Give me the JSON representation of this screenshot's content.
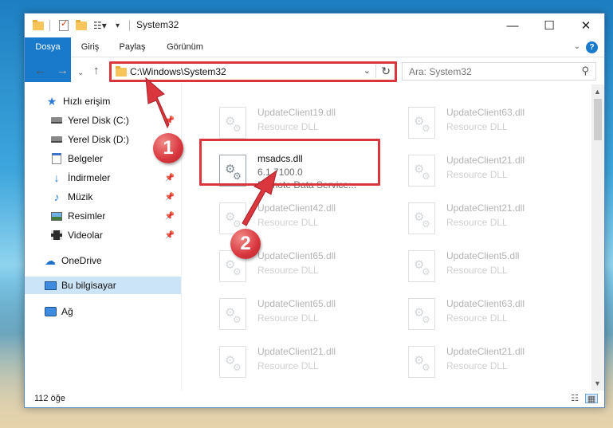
{
  "window": {
    "title": "System32",
    "minimize_glyph": "—",
    "maximize_glyph": "☐",
    "close_glyph": "✕"
  },
  "ribbon": {
    "tabs": [
      "Dosya",
      "Giriş",
      "Paylaş",
      "Görünüm"
    ],
    "help_glyph": "?"
  },
  "nav": {
    "address_path": "C:\\Windows\\System32",
    "search_placeholder": "Ara: System32"
  },
  "sidebar": {
    "items": [
      {
        "label": "Hızlı erişim",
        "icon": "star-icon"
      },
      {
        "label": "Yerel Disk (C:)",
        "icon": "disk-icon",
        "pinned": true
      },
      {
        "label": "Yerel Disk (D:)",
        "icon": "disk-icon",
        "pinned": true
      },
      {
        "label": "Belgeler",
        "icon": "documents-icon",
        "pinned": true
      },
      {
        "label": "İndirmeler",
        "icon": "download-icon",
        "pinned": true
      },
      {
        "label": "Müzik",
        "icon": "music-icon",
        "pinned": true
      },
      {
        "label": "Resimler",
        "icon": "pictures-icon",
        "pinned": true
      },
      {
        "label": "Videolar",
        "icon": "videos-icon",
        "pinned": true
      },
      {
        "label": "OneDrive",
        "icon": "cloud-icon"
      },
      {
        "label": "Bu bilgisayar",
        "icon": "computer-icon",
        "selected": true
      },
      {
        "label": "Ağ",
        "icon": "network-icon"
      }
    ]
  },
  "files": {
    "left": [
      {
        "name": "UpdateClient19.dll",
        "type": "Resource DLL"
      },
      {
        "name": "msadcs.dll",
        "version": "6.1.7100.0",
        "description": "Remote Data Service...",
        "highlighted": true
      },
      {
        "name": "UpdateClient42.dll",
        "type": "Resource DLL"
      },
      {
        "name": "UpdateClient65.dll",
        "type": "Resource DLL"
      },
      {
        "name": "UpdateClient65.dll",
        "type": "Resource DLL"
      },
      {
        "name": "UpdateClient21.dll",
        "type": "Resource DLL"
      }
    ],
    "right": [
      {
        "name": "UpdateClient63.dll",
        "type": "Resource DLL"
      },
      {
        "name": "UpdateClient21.dll",
        "type": "Resource DLL"
      },
      {
        "name": "UpdateClient21.dll",
        "type": "Resource DLL"
      },
      {
        "name": "UpdateClient5.dll",
        "type": "Resource DLL"
      },
      {
        "name": "UpdateClient63.dll",
        "type": "Resource DLL"
      },
      {
        "name": "UpdateClient21.dll",
        "type": "Resource DLL"
      }
    ]
  },
  "status": {
    "item_count": "112 öğe"
  },
  "annotations": {
    "step1": "1",
    "step2": "2",
    "color": "#d9363e"
  }
}
